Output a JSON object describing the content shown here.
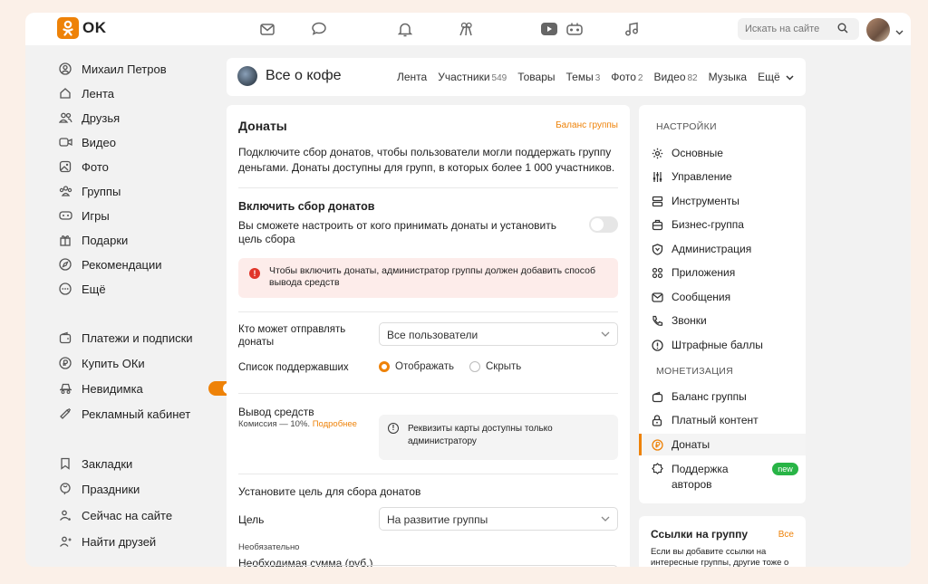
{
  "colors": {
    "accent": "#ee8208",
    "alert_bg": "#fdecea",
    "alert_icon": "#e0352a",
    "new_badge": "#28b446"
  },
  "topbar": {
    "logo_text": "OK",
    "search_placeholder": "Искать на сайте",
    "icons": [
      "mail-icon",
      "chat-icon",
      "bell-icon",
      "fireworks-icon",
      "video-icon",
      "gamepad-icon",
      "music-icon"
    ]
  },
  "leftnav": {
    "items": [
      {
        "label": "Михаил Петров",
        "icon": "user-icon"
      },
      {
        "label": "Лента",
        "icon": "home-icon"
      },
      {
        "label": "Друзья",
        "icon": "friends-icon"
      },
      {
        "label": "Видео",
        "icon": "video-icon"
      },
      {
        "label": "Фото",
        "icon": "photo-icon"
      },
      {
        "label": "Группы",
        "icon": "groups-icon"
      },
      {
        "label": "Игры",
        "icon": "gamepad-icon"
      },
      {
        "label": "Подарки",
        "icon": "gift-icon"
      },
      {
        "label": "Рекомендации",
        "icon": "compass-icon"
      },
      {
        "label": "Ещё",
        "icon": "more-icon"
      },
      {
        "label": "Платежи и подписки",
        "icon": "wallet-icon"
      },
      {
        "label": "Купить ОКи",
        "icon": "coin-icon"
      },
      {
        "label": "Невидимка",
        "icon": "incognito-icon",
        "toggle": true
      },
      {
        "label": "Рекламный кабинет",
        "icon": "megaphone-icon"
      },
      {
        "label": "Закладки",
        "icon": "bookmark-icon"
      },
      {
        "label": "Праздники",
        "icon": "balloon-icon"
      },
      {
        "label": "Сейчас на сайте",
        "icon": "online-icon"
      },
      {
        "label": "Найти друзей",
        "icon": "add-friend-icon"
      }
    ]
  },
  "group": {
    "title": "Все о кофе",
    "tabs": [
      {
        "label": "Лента",
        "count": ""
      },
      {
        "label": "Участники",
        "count": "549"
      },
      {
        "label": "Товары",
        "count": ""
      },
      {
        "label": "Темы",
        "count": "3"
      },
      {
        "label": "Фото",
        "count": "2"
      },
      {
        "label": "Видео",
        "count": "82"
      },
      {
        "label": "Музыка",
        "count": ""
      },
      {
        "label": "Ещё",
        "count": ""
      }
    ]
  },
  "donations": {
    "title": "Донаты",
    "balance_link": "Баланс группы",
    "description": "Подключите сбор донатов, чтобы пользователи могли поддержать группу деньгами. Донаты доступны для групп, в которых более 1 000 участников.",
    "enable_title": "Включить сбор донатов",
    "enable_desc": "Вы сможете настроить от кого принимать донаты и установить цель сбора",
    "alert": "Чтобы включить донаты, администратор группы должен добавить способ вывода средств",
    "who_label": "Кто может отправлять донаты",
    "who_value": "Все пользователи",
    "supporters_label": "Список поддержавших",
    "supporters_show": "Отображать",
    "supporters_hide": "Скрыть",
    "withdraw_title": "Вывод средств",
    "withdraw_commission": "Комиссия — 10%.",
    "withdraw_more": "Подробнее",
    "withdraw_info": "Реквизиты карты доступны только администратору",
    "goal_section": "Установите цель для сбора донатов",
    "goal_label": "Цель",
    "goal_value": "На развитие группы",
    "optional": "Необязательно",
    "amount_label": "Необходимая сумма (руб.)"
  },
  "settings": {
    "head_settings": "НАСТРОЙКИ",
    "head_monetization": "МОНЕТИЗАЦИЯ",
    "items": [
      {
        "label": "Основные",
        "icon": "gear-icon"
      },
      {
        "label": "Управление",
        "icon": "sliders-icon"
      },
      {
        "label": "Инструменты",
        "icon": "tools-icon"
      },
      {
        "label": "Бизнес-группа",
        "icon": "briefcase-icon"
      },
      {
        "label": "Администрация",
        "icon": "shield-icon"
      },
      {
        "label": "Приложения",
        "icon": "apps-icon"
      },
      {
        "label": "Сообщения",
        "icon": "mail-icon"
      },
      {
        "label": "Звонки",
        "icon": "phone-icon"
      },
      {
        "label": "Штрафные баллы",
        "icon": "warning-icon"
      }
    ],
    "monetization_items": [
      {
        "label": "Баланс группы",
        "icon": "wallet-icon"
      },
      {
        "label": "Платный контент",
        "icon": "lock-icon"
      },
      {
        "label": "Донаты",
        "icon": "ruble-coin-icon",
        "active": true
      },
      {
        "label": "Поддержка авторов",
        "icon": "badge-icon",
        "badge": "new"
      }
    ]
  },
  "links": {
    "title": "Ссылки на группу",
    "all": "Все",
    "desc": "Если вы добавите ссылки на интересные группы, другие тоже о"
  }
}
